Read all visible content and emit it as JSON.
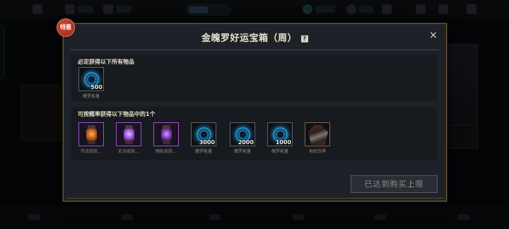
{
  "dialog": {
    "badge": "特惠",
    "title": "金魄罗好运宝箱（周）",
    "help_icon": "?",
    "close_icon": "×",
    "guaranteed_section_title": "必定获得以下所有物品",
    "chance_section_title": "可按概率获得以下物品中的1个",
    "buy_button_label": "已达到购买上限"
  },
  "guaranteed_items": [
    {
      "name": "魄罗能量",
      "qty": "500",
      "icon": "blue-orb-icon"
    }
  ],
  "chance_items": [
    {
      "name": "传说皮肤…",
      "qty": "",
      "icon": "orange-lantern-icon",
      "rarity": "purple"
    },
    {
      "name": "史诗皮肤…",
      "qty": "",
      "icon": "violet-lantern-icon",
      "rarity": "purple"
    },
    {
      "name": "随机皮肤…",
      "qty": "",
      "icon": "violet-lantern-icon",
      "rarity": "purple"
    },
    {
      "name": "魄罗能量",
      "qty": "3000",
      "icon": "blue-orb-icon",
      "rarity": "normal"
    },
    {
      "name": "魄罗能量",
      "qty": "2000",
      "icon": "blue-orb-icon",
      "rarity": "normal"
    },
    {
      "name": "魄罗能量",
      "qty": "1000",
      "icon": "blue-orb-icon",
      "rarity": "normal"
    },
    {
      "name": "地底世界",
      "qty": "",
      "icon": "armor-icon",
      "rarity": "gold"
    }
  ],
  "colors": {
    "dialog_bg": "#1e2228",
    "gold_border": "#6d5a34",
    "purple_rarity": "#9a55c9",
    "badge_red": "#c23a2a"
  }
}
